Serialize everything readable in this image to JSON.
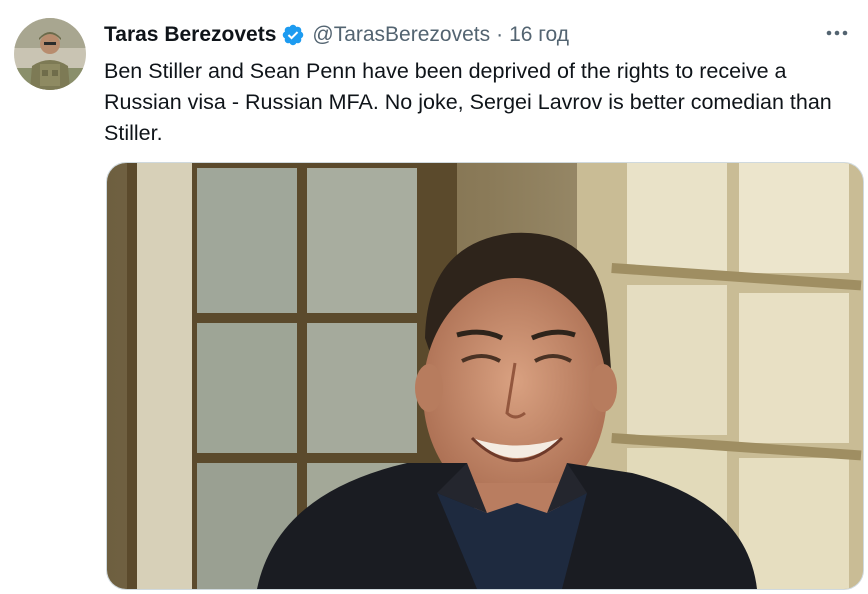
{
  "tweet": {
    "author_name": "Taras Berezovets",
    "handle": "@TarasBerezovets",
    "separator": "·",
    "time": "16 год",
    "more_label": "···",
    "text": "Ben Stiller and Sean Penn have been deprived of the rights to receive a Russian visa - Russian MFA. No joke, Sergei Lavrov is better comedian than Stiller.",
    "avatar_icon": "avatar-icon",
    "verified_icon": "verified-badge-icon",
    "verified_color": "#1d9bf0",
    "text_color": "#0f1419",
    "secondary_color": "#536471"
  }
}
